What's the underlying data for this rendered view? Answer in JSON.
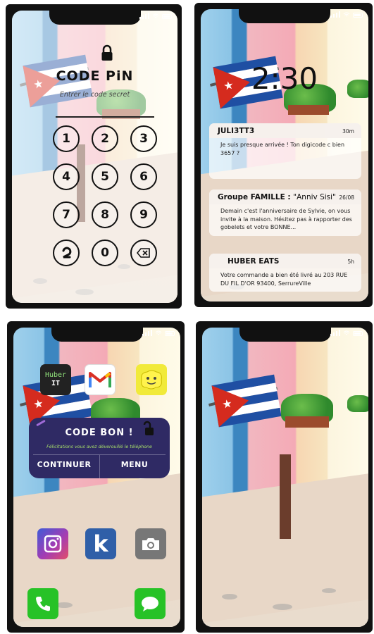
{
  "colors": {
    "dialog_bg": "#2f2a64",
    "dialog_subtitle": "#a8e06a",
    "huber_green": "#8fe07a",
    "app_phone_green": "#27c227"
  },
  "screen_pin": {
    "lock_icon": "padlock-icon",
    "title": "CODE PiN",
    "subtitle": "Entrer le code secret",
    "keys": [
      {
        "label": "1",
        "icon": null
      },
      {
        "label": "2",
        "icon": null
      },
      {
        "label": "3",
        "icon": null
      },
      {
        "label": "4",
        "icon": null
      },
      {
        "label": "5",
        "icon": null
      },
      {
        "label": "6",
        "icon": null
      },
      {
        "label": "7",
        "icon": null
      },
      {
        "label": "8",
        "icon": null
      },
      {
        "label": "9",
        "icon": null
      },
      {
        "label": "",
        "icon": "back-arrow-icon"
      },
      {
        "label": "0",
        "icon": null
      },
      {
        "label": "",
        "icon": "delete-icon"
      }
    ]
  },
  "screen_lock": {
    "clock": "2:30",
    "notifications": [
      {
        "title": "JULI3TT3",
        "title_extra": "",
        "time": "30m",
        "body": "Je suis presque arrivée ! Ton digicode c bien 3657 ?"
      },
      {
        "title": "Groupe FAMILLE :",
        "title_extra": "\"Anniv Sisi\"",
        "time": "26/08",
        "body": "Demain c'est l'anniversaire de Sylvie, on vous invite à la maison. Hésitez pas à rapporter des gobelets  et votre BONNE..."
      },
      {
        "title": "HUBER EATS",
        "title_extra": "",
        "time": "5h",
        "body": "Votre commande a bien été livré au 203 RUE DU FIL D'OR 93400, SerrureVille"
      }
    ]
  },
  "screen_home": {
    "apps_top": [
      {
        "name": "huber-it-app",
        "line1": "Huber",
        "line2": "IT"
      },
      {
        "name": "gmail-app-icon"
      },
      {
        "name": "smiley-app-icon"
      }
    ],
    "dialog": {
      "title": "CODE BON !",
      "subtitle": "Félicitations vous avez déverouillé le téléphone",
      "continue_label": "CONTINUER",
      "menu_label": "MENU",
      "icon": "open-padlock-icon"
    },
    "apps_middle": [
      "instagram-icon",
      "k-app-icon",
      "camera-icon"
    ],
    "apps_k_letter": "k",
    "dock": [
      "phone-call-icon",
      "messages-icon"
    ]
  }
}
